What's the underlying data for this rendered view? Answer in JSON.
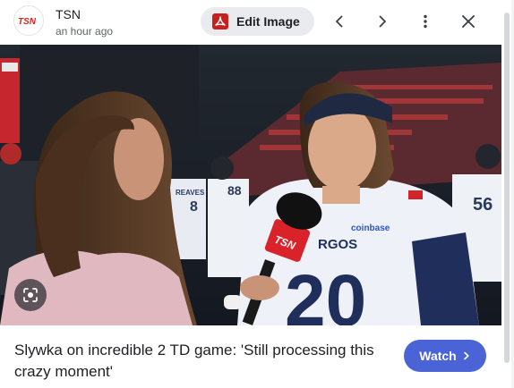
{
  "source": {
    "logo_text": "TSN",
    "name": "TSN",
    "timestamp": "an hour ago"
  },
  "toolbar": {
    "edit_image_label": "Edit Image",
    "prev_icon": "chevron-left-icon",
    "next_icon": "chevron-right-icon",
    "more_icon": "more-vert-icon",
    "close_icon": "close-icon"
  },
  "photo": {
    "mic_flag_text": "TSN",
    "jersey_sponsor": "coinbase",
    "jersey_team_partial": "RGOS",
    "jersey_number": "20",
    "bg_jersey_1_name": "REAVES",
    "bg_jersey_1_number": "8",
    "bg_jersey_2_number": "88",
    "bg_jersey_3_number": "56",
    "lens_icon": "google-lens-icon"
  },
  "caption": {
    "text": "Slywka on incredible 2 TD game: 'Still processing this crazy moment'",
    "watch_label": "Watch",
    "watch_icon": "chevron-right-icon"
  },
  "colors": {
    "tsn_red": "#e2231a",
    "watch_blue": "#4a64d8",
    "edit_bg": "#e9ebee"
  }
}
